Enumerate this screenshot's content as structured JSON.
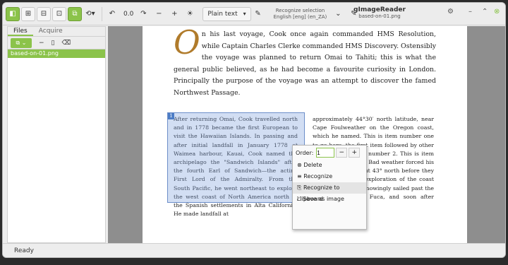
{
  "toolbar": {
    "zoom": "0.0",
    "output_mode": "Plain text",
    "recognize_label": "Recognize selection",
    "recognize_lang": "English [eng] (en_ZA)"
  },
  "title": {
    "app": "gImageReader",
    "file": "based-on-01.png"
  },
  "sidebar": {
    "tabs": [
      "Files",
      "Acquire"
    ],
    "files": [
      "based-on-01.png"
    ]
  },
  "document": {
    "dropcap": "O",
    "para1": "n his last voyage, Cook once again commanded HMS Resolution, while Captain Charles Clerke commanded HMS Discovery. Ostensibly the voyage was planned to return Omai to Tahiti; this is what the general public believed, as he had become a favourite curiosity in London. Principally the purpose of the voyage was an attempt to discover the famed Northwest Passage.",
    "col1": "After returning Omai, Cook travelled north and in 1778 became the first European to visit the Hawaiian Islands. In passing and after initial landfall in January 1778 at Waimea harbour, Kauai, Cook named the archipelago the \"Sandwich Islands\" after the fourth Earl of Sandwich—the acting First Lord of the Admiralty. From the South Pacific, he went northeast to explore the west coast of North America north of the Spanish settlements in Alta California. He made landfall at",
    "col2": "approximately 44°30′ north latitude, near Cape Foulweather on the Oregon coast, which he named. This is item number one to go here, the first item followed by other items. This is item number 2. This is item number 3 etcetera. Bad weather forced his ships south to about 43° north before they could begin their exploration of the coast northward. He unknowingly sailed past the Strait of Juan de Fuca, and soon after entered"
  },
  "selection": {
    "number": "1"
  },
  "context_menu": {
    "order_label": "Order:",
    "order_value": "1",
    "minus": "−",
    "plus": "+",
    "items": [
      "Delete",
      "Recognize",
      "Recognize to clipboard",
      "Save as image"
    ]
  },
  "status": "Ready"
}
